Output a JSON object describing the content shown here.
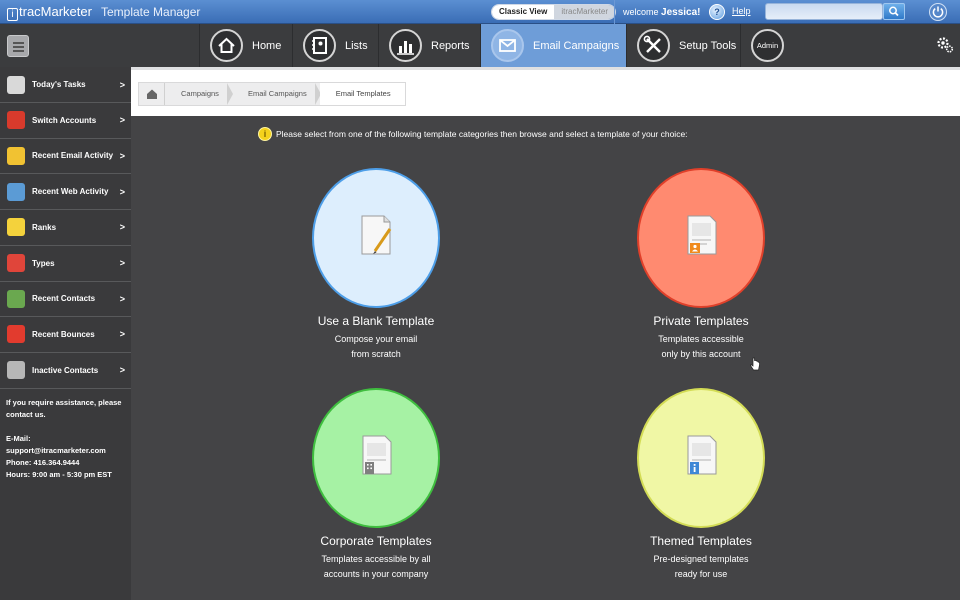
{
  "topbar": {
    "logo_prefix": "i",
    "logo_text": "tracMarketer",
    "app_title": "Template Manager",
    "view_toggle": [
      "Classic View",
      "itracMarketer"
    ],
    "welcome_text": "welcome",
    "user_name": "Jessica!",
    "help_label": "Help",
    "search_placeholder": ""
  },
  "nav": {
    "items": [
      {
        "label": "Home",
        "icon": "home-icon"
      },
      {
        "label": "Lists",
        "icon": "address-book-icon"
      },
      {
        "label": "Reports",
        "icon": "bar-chart-icon"
      },
      {
        "label": "Email Campaigns",
        "icon": "envelope-icon",
        "active": true
      },
      {
        "label": "Setup Tools",
        "icon": "tools-icon"
      },
      {
        "label": "Admin",
        "icon": "admin-icon"
      }
    ]
  },
  "sidebar": {
    "items": [
      {
        "label": "Today's Tasks",
        "icon": "tasks-icon",
        "color": "#d9d9d9"
      },
      {
        "label": "Switch Accounts",
        "icon": "switch-accounts-icon",
        "color": "#d83a2c"
      },
      {
        "label": "Recent Email Activity",
        "icon": "email-activity-icon",
        "color": "#f1c232"
      },
      {
        "label": "Recent Web Activity",
        "icon": "web-activity-icon",
        "color": "#5b9bd5"
      },
      {
        "label": "Ranks",
        "icon": "ranks-icon",
        "color": "#f4d23c"
      },
      {
        "label": "Types",
        "icon": "types-icon",
        "color": "#e0453a"
      },
      {
        "label": "Recent Contacts",
        "icon": "recent-contacts-icon",
        "color": "#6aa84f"
      },
      {
        "label": "Recent Bounces",
        "icon": "bounces-icon",
        "color": "#e23b2e"
      },
      {
        "label": "Inactive Contacts",
        "icon": "inactive-contacts-icon",
        "color": "#b7b7b7"
      }
    ],
    "arrow": ">",
    "assist_text": "If you require assistance, please contact us.",
    "email_label": "E-Mail:",
    "email": "support@itracmarketer.com",
    "phone": "Phone: 416.364.9444",
    "hours": "Hours: 9:00 am - 5:30 pm EST"
  },
  "breadcrumb": [
    "Campaigns",
    "Email Campaigns",
    "Email Templates"
  ],
  "instruction": "Please select from one of the following template categories then browse and select a template of your choice:",
  "cards": [
    {
      "title": "Use a Blank Template",
      "line1": "Compose your email",
      "line2": "from scratch",
      "color": "#ddeefd",
      "border": "#4d9ee8",
      "icon": "blank-template-icon"
    },
    {
      "title": "Private Templates",
      "line1": "Templates accessible",
      "line2": "only by this account",
      "color": "#ff8a70",
      "border": "#e0402a",
      "icon": "private-template-icon"
    },
    {
      "title": "Corporate Templates",
      "line1": "Templates accessible by all",
      "line2": "accounts in your company",
      "color": "#a6f2a4",
      "border": "#3fbe3f",
      "icon": "corporate-template-icon"
    },
    {
      "title": "Themed Templates",
      "line1": "Pre-designed templates",
      "line2": "ready for use",
      "color": "#f0f7a5",
      "border": "#d3dc55",
      "icon": "themed-template-icon"
    }
  ]
}
